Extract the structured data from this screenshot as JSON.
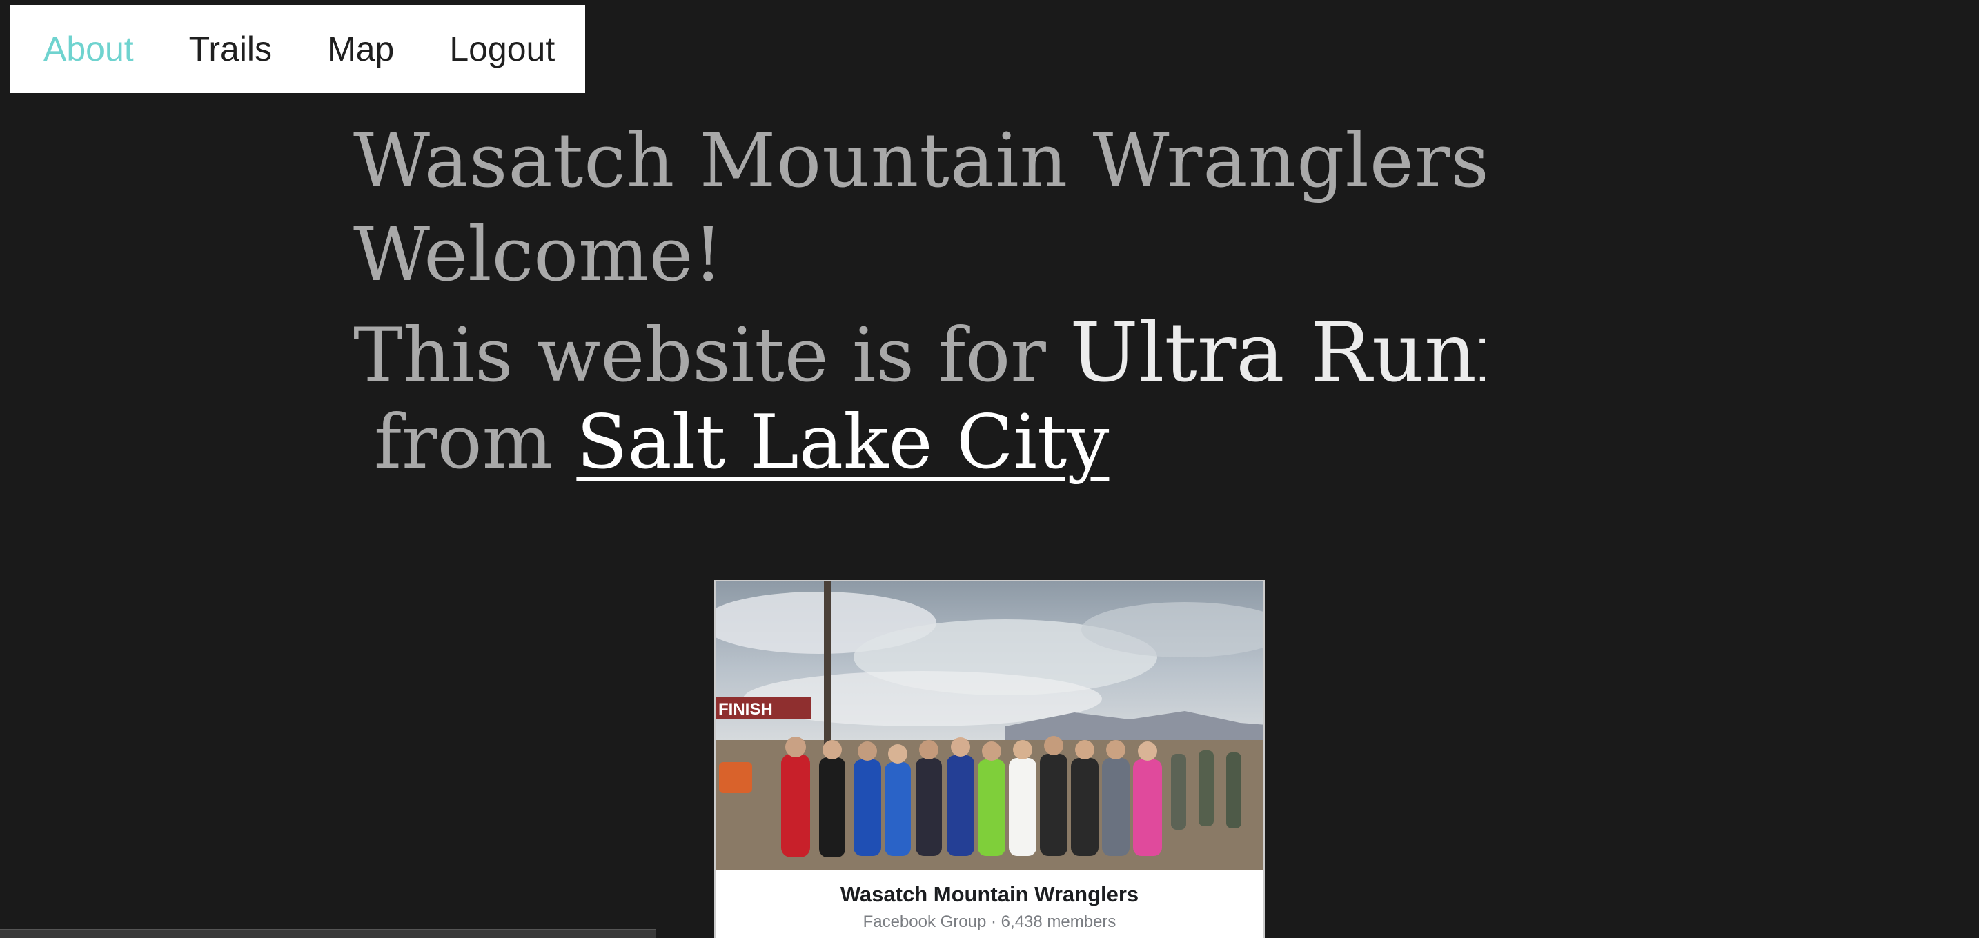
{
  "nav": {
    "items": [
      {
        "label": "About",
        "active": true
      },
      {
        "label": "Trails",
        "active": false
      },
      {
        "label": "Map",
        "active": false
      },
      {
        "label": "Logout",
        "active": false
      }
    ],
    "active_color": "#6fd3cf"
  },
  "hero": {
    "title": "Wasatch Mountain Wranglers",
    "welcome": "Welcome!",
    "intro_prefix": "This website is for",
    "intro_highlight": "Ultra Runners",
    "from_prefix": "from",
    "city_link": "Salt Lake City"
  },
  "fb_card": {
    "photo_sign": "FINISH",
    "group_name": "Wasatch Mountain Wranglers",
    "group_meta": "Facebook Group · 6,438 members"
  },
  "colors": {
    "background": "#1a1a1a",
    "heading": "#a9a9a9",
    "highlight": "#ececec"
  }
}
